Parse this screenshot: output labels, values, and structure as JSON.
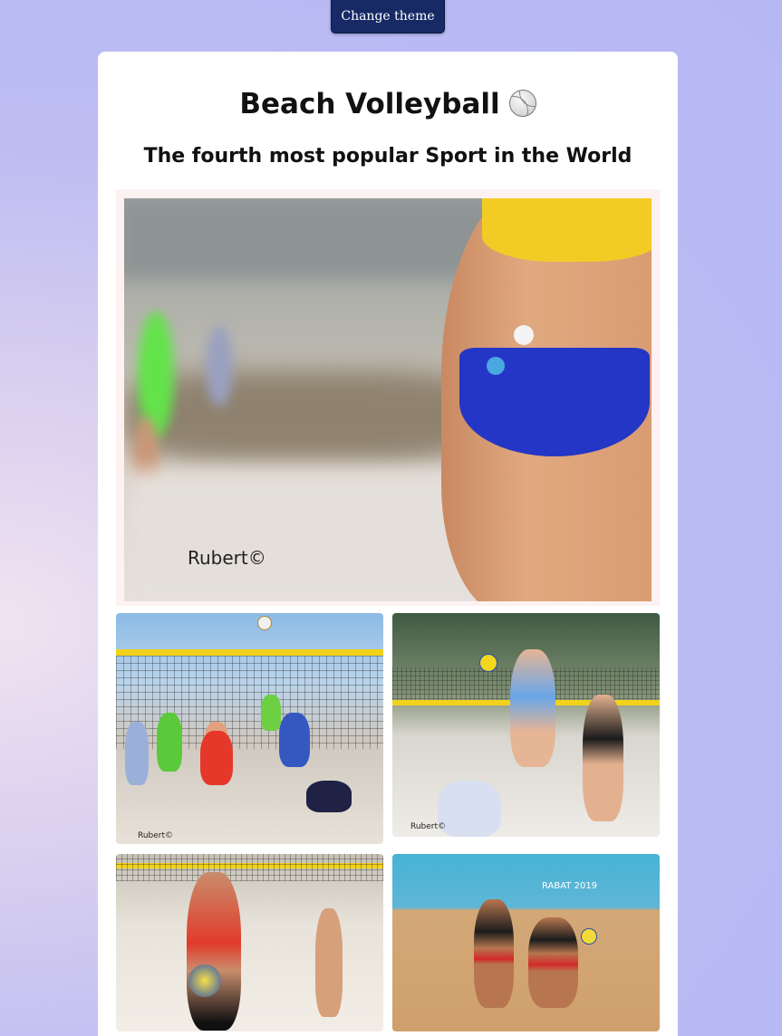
{
  "toolbar": {
    "theme_button_label": "Change theme"
  },
  "page": {
    "title": "Beach Volleyball",
    "subtitle": "The fourth most popular Sport in the World"
  },
  "images": {
    "hero": {
      "watermark": "Rubert©"
    },
    "thumb1": {
      "watermark": "Rubert©"
    },
    "thumb2": {
      "watermark": "Rubert©"
    },
    "thumb4": {
      "banner_text": "RABAT 2019"
    }
  },
  "icons": {
    "title_icon": "volleyball-icon"
  }
}
